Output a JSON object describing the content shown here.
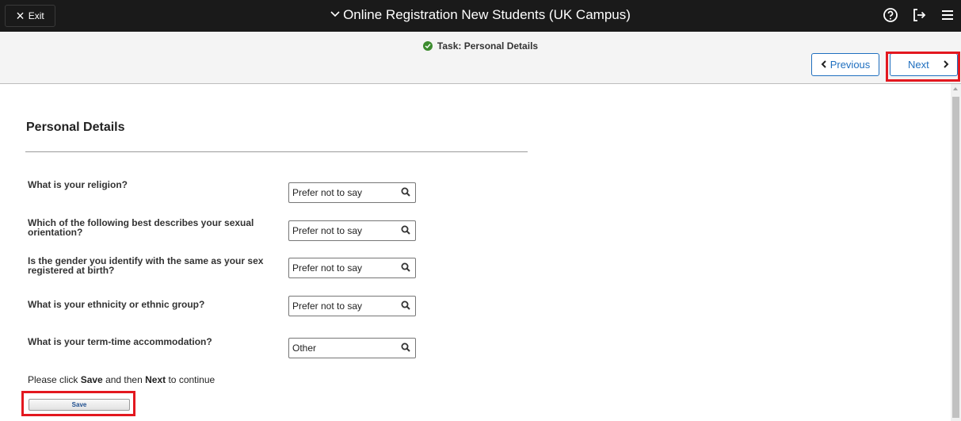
{
  "topbar": {
    "exit_label": "Exit",
    "title": "Online Registration New Students (UK Campus)",
    "icons": [
      "help-icon",
      "signout-icon",
      "menu-icon"
    ]
  },
  "task": {
    "title": "Task: Personal Details",
    "previous_label": "Previous",
    "next_label": "Next"
  },
  "form": {
    "section_title": "Personal Details",
    "questions": [
      {
        "label": "What is your religion?",
        "value": "Prefer not to say"
      },
      {
        "label": "Which of the following best describes your sexual orientation?",
        "value": "Prefer not to say"
      },
      {
        "label": "Is the gender you identify with the same as your sex registered at birth?",
        "value": "Prefer not to say"
      },
      {
        "label": "What is your ethnicity or ethnic group?",
        "value": "Prefer not to say"
      },
      {
        "label": "What is your term-time accommodation?",
        "value": "Other"
      }
    ],
    "instruction": {
      "pre": "Please click ",
      "save_word": "Save",
      "mid": " and then ",
      "next_word": "Next",
      "post": " to continue"
    },
    "save_label": "Save"
  },
  "colors": {
    "topbar": "#1a1a1a",
    "accent": "#1f6fbf",
    "highlight": "#e3181f",
    "success": "#3c8b2e"
  }
}
